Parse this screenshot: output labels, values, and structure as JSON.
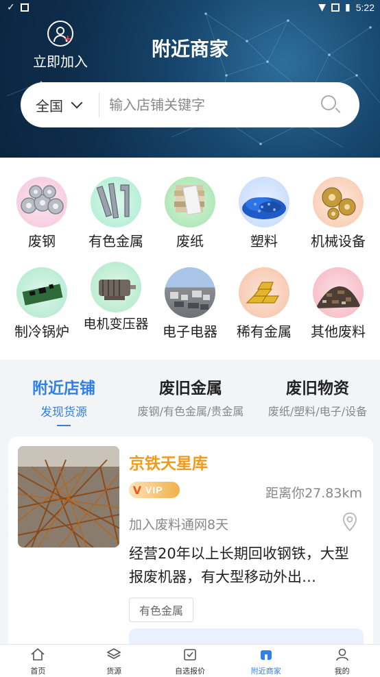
{
  "status_bar": {
    "time": "5:22"
  },
  "header": {
    "join_label": "立即加入",
    "title": "附近商家"
  },
  "search": {
    "region": "全国",
    "placeholder": "输入店铺关键字"
  },
  "categories": [
    {
      "label": "废钢",
      "icon": "steel-coils-icon"
    },
    {
      "label": "有色金属",
      "icon": "metal-profiles-icon"
    },
    {
      "label": "废纸",
      "icon": "paper-stack-icon"
    },
    {
      "label": "塑料",
      "icon": "plastic-pellets-icon"
    },
    {
      "label": "机械设备",
      "icon": "gears-icon"
    },
    {
      "label": "制冷锅炉",
      "icon": "circuit-board-icon"
    },
    {
      "label": "电机变压器",
      "icon": "motor-icon"
    },
    {
      "label": "电子电器",
      "icon": "electronics-scrap-icon"
    },
    {
      "label": "稀有金属",
      "icon": "gold-bars-icon"
    },
    {
      "label": "其他废料",
      "icon": "scrap-pile-icon"
    }
  ],
  "tabs": [
    {
      "title": "附近店铺",
      "subtitle": "发现货源",
      "active": true
    },
    {
      "title": "废旧金属",
      "subtitle": "废钢/有色金属/贵金属",
      "active": false
    },
    {
      "title": "废旧物资",
      "subtitle": "废纸/塑料/电子/设备",
      "active": false
    }
  ],
  "shop": {
    "name": "京铁天星库",
    "vip_label": "VIP",
    "distance": "距离你27.83km",
    "joined": "加入废料通网8天",
    "description": "经营20年以上长期回收钢铁，大型报废机器，有大型移动外出…",
    "tag": "有色金属"
  },
  "bottom_nav": [
    {
      "label": "首页",
      "icon": "home-icon",
      "active": false
    },
    {
      "label": "货源",
      "icon": "layers-icon",
      "active": false
    },
    {
      "label": "自选报价",
      "icon": "checklist-icon",
      "active": false
    },
    {
      "label": "附近商家",
      "icon": "store-icon",
      "active": true
    },
    {
      "label": "我的",
      "icon": "person-icon",
      "active": false
    }
  ],
  "colors": {
    "accent": "#2f80ed",
    "shop_name": "#f39a1a",
    "header_bg": "#17466d"
  }
}
